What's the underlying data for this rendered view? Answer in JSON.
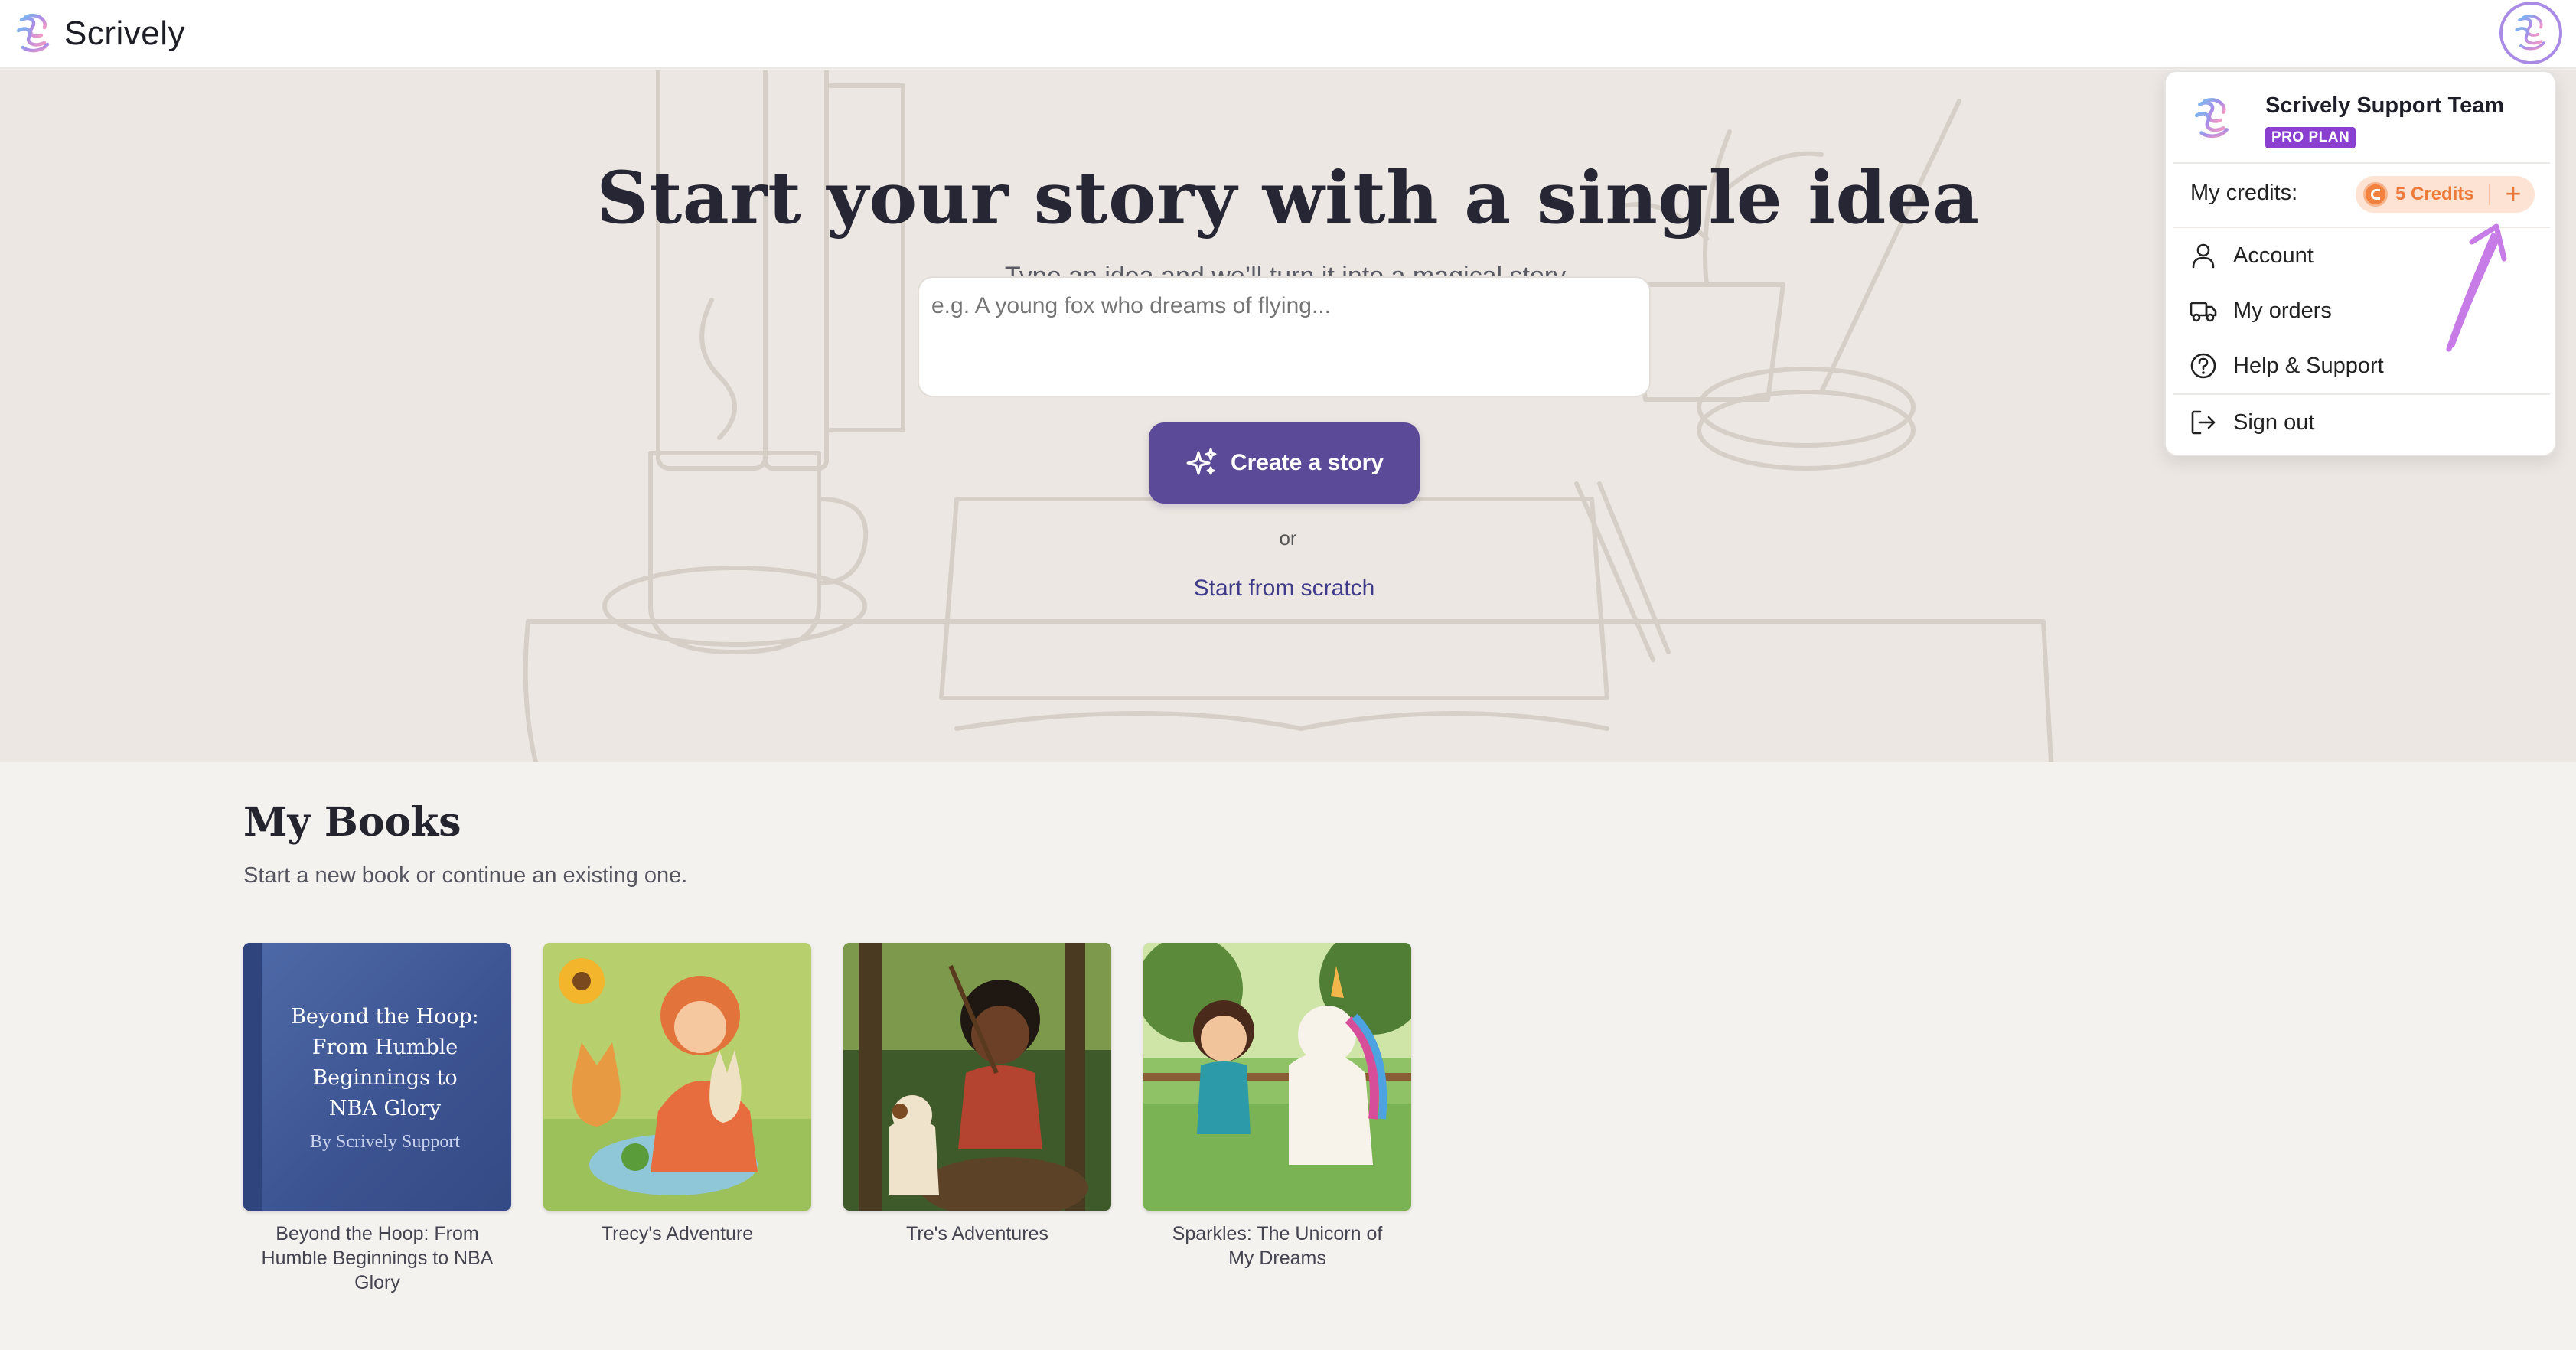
{
  "header": {
    "app_name": "Scrively",
    "logo_icon": "scrively-logo-icon",
    "avatar_icon": "scrively-avatar-icon"
  },
  "hero": {
    "title": "Start your story with a single idea",
    "subtitle": "Type an idea and we’ll turn it into a magical story.",
    "idea_input": {
      "value": "",
      "placeholder": "e.g. A young fox who dreams of flying..."
    },
    "create_button": "Create a story",
    "create_icon": "sparkles-icon",
    "or": "or",
    "scratch_link": "Start from scratch"
  },
  "books": {
    "title": "My Books",
    "subtitle": "Start a new book or continue an existing one.",
    "items": [
      {
        "cover_title": "Beyond the Hoop: From Humble Beginnings to NBA Glory",
        "cover_author": "By Scrively Support",
        "caption": "Beyond the Hoop: From Humble Beginnings to NBA Glory"
      },
      {
        "caption": "Trecy's Adventure"
      },
      {
        "caption": "Tre's Adventures"
      },
      {
        "caption": "Sparkles: The Unicorn of My Dreams"
      }
    ]
  },
  "menu": {
    "user_name": "Scrively Support Team",
    "plan_badge": "PRO PLAN",
    "credits_label": "My credits:",
    "credits_value": "5 Credits",
    "add_credits": "+",
    "items": [
      {
        "label": "Account",
        "icon": "user-icon"
      },
      {
        "label": "My orders",
        "icon": "truck-icon"
      },
      {
        "label": "Help & Support",
        "icon": "help-circle-icon"
      },
      {
        "label": "Sign out",
        "icon": "log-out-icon"
      }
    ]
  },
  "colors": {
    "accent": "#5b4a97",
    "link": "#3f3a8a",
    "pro_badge": "#8b3fd1",
    "credits": "#ee7a3a",
    "annotation_arrow": "#c77be6"
  }
}
